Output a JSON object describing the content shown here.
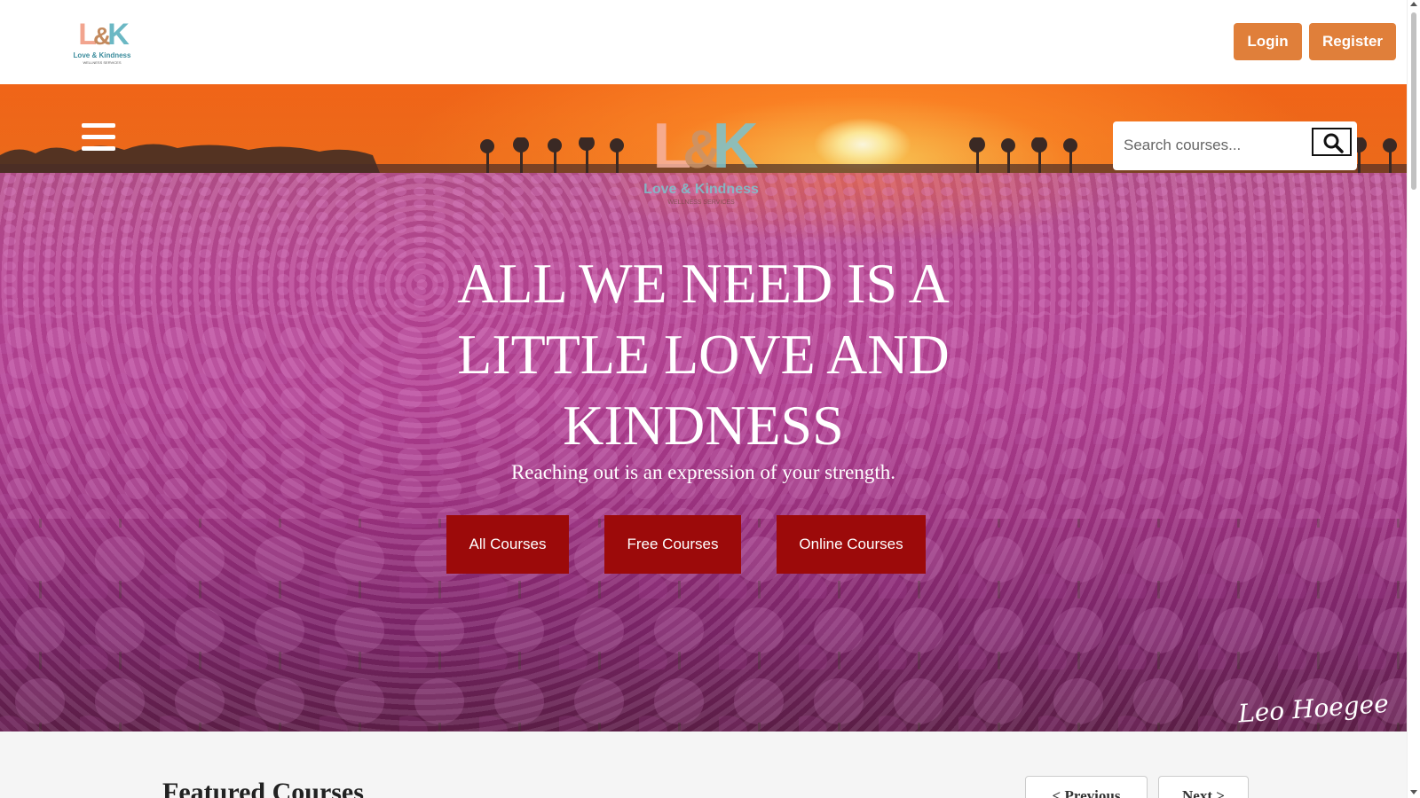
{
  "header": {
    "logo": {
      "letters": "L&K",
      "name": "Love & Kindness",
      "tagline": "WELLNESS SERVICES"
    },
    "login_label": "Login",
    "register_label": "Register",
    "accent_color": "#e07f3a"
  },
  "hero": {
    "menu_icon": "hamburger-icon",
    "logo": {
      "letters": "L&K",
      "name": "Love & Kindness",
      "tagline": "WELLNESS SERVICES"
    },
    "search": {
      "placeholder": "Search courses...",
      "value": "",
      "icon": "search-icon"
    },
    "heading": "ALL WE NEED IS A LITTLE LOVE AND KINDNESS",
    "subheading": "Reaching out is an expression of your strength.",
    "buttons": [
      {
        "label": "All Courses"
      },
      {
        "label": "Free Courses"
      },
      {
        "label": "Online Courses"
      }
    ],
    "button_color": "#9c0a0a",
    "signature": "Leo Hoegee"
  },
  "featured": {
    "title": "Featured Courses",
    "prev_label": "< Previous",
    "next_label": "Next >"
  }
}
